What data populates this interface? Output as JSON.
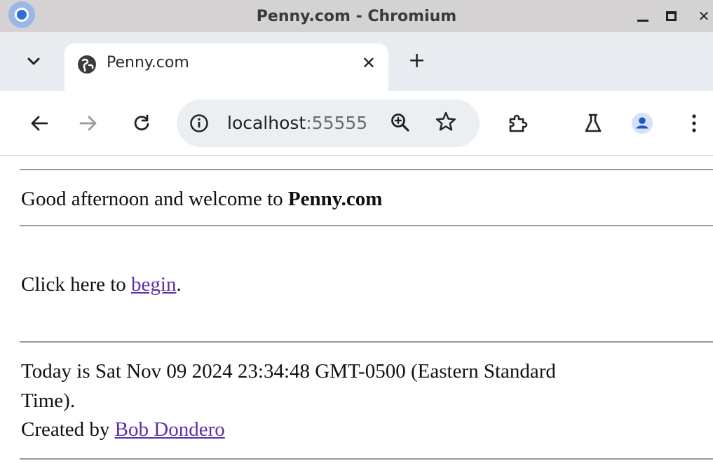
{
  "window": {
    "title": "Penny.com - Chromium"
  },
  "tabs": [
    {
      "title": "Penny.com",
      "favicon": "globe-icon"
    }
  ],
  "toolbar": {
    "url_host": "localhost",
    "url_port": ":55555"
  },
  "page": {
    "greeting_prefix": "Good afternoon and welcome to ",
    "site_name": "Penny.com",
    "click_prefix": "Click here to ",
    "begin_link": "begin",
    "click_suffix": ".",
    "date_line_1": "Today is Sat Nov 09 2024 23:34:48 GMT-0500 (Eastern Standard",
    "date_line_2": "Time).",
    "created_prefix": "Created by ",
    "author_link": "Bob Dondero"
  },
  "colors": {
    "link": "#5a31a6",
    "avatar": "#1a57c8",
    "avatar_bg": "#d5e2f7"
  }
}
